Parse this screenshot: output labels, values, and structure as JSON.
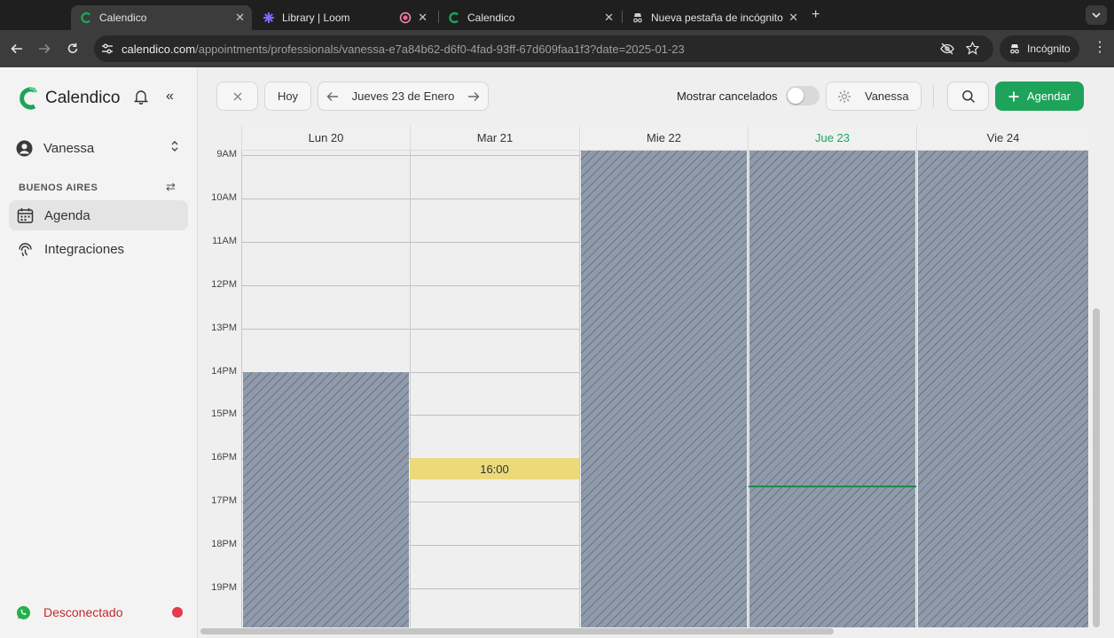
{
  "browser": {
    "tabs": [
      {
        "title": "Calendico",
        "active": true
      },
      {
        "title": "Library | Loom",
        "active": false
      },
      {
        "title": "",
        "active": false,
        "recording": true
      },
      {
        "title": "Calendico",
        "active": false
      },
      {
        "title": "Nueva pestaña de incógnito",
        "active": false
      }
    ],
    "url_host": "calendico.com",
    "url_path": "/appointments/professionals/vanessa-e7a84b62-d6f0-4fad-93ff-67d609faa1f3?date=2025-01-23",
    "incognito_label": "Incógnito"
  },
  "sidebar": {
    "brand": "Calendico",
    "user": "Vanessa",
    "location": "BUENOS AIRES",
    "nav": [
      {
        "label": "Agenda",
        "selected": true,
        "icon": "calendar-icon"
      },
      {
        "label": "Integraciones",
        "selected": false,
        "icon": "fingerprint-icon"
      }
    ],
    "status": "Desconectado"
  },
  "header": {
    "today_label": "Hoy",
    "date_label": "Jueves 23 de Enero",
    "show_cancelled_label": "Mostrar cancelados",
    "show_cancelled": false,
    "professional": "Vanessa",
    "new_label": "Agendar"
  },
  "calendar": {
    "days": [
      {
        "label": "Lun 20",
        "today": false
      },
      {
        "label": "Mar 21",
        "today": false
      },
      {
        "label": "Mie 22",
        "today": false
      },
      {
        "label": "Jue 23",
        "today": true
      },
      {
        "label": "Vie 24",
        "today": false
      }
    ],
    "hours": [
      "9AM",
      "10AM",
      "11AM",
      "12PM",
      "13PM",
      "14PM",
      "15PM",
      "16PM",
      "17PM",
      "18PM",
      "19PM"
    ],
    "appointment": {
      "day": "Mar 21",
      "label": "16:00"
    }
  },
  "colors": {
    "accent": "#1ea35b",
    "blocked": "#8f9aab",
    "appointment": "#ecd97a",
    "status_error": "#e53950"
  }
}
